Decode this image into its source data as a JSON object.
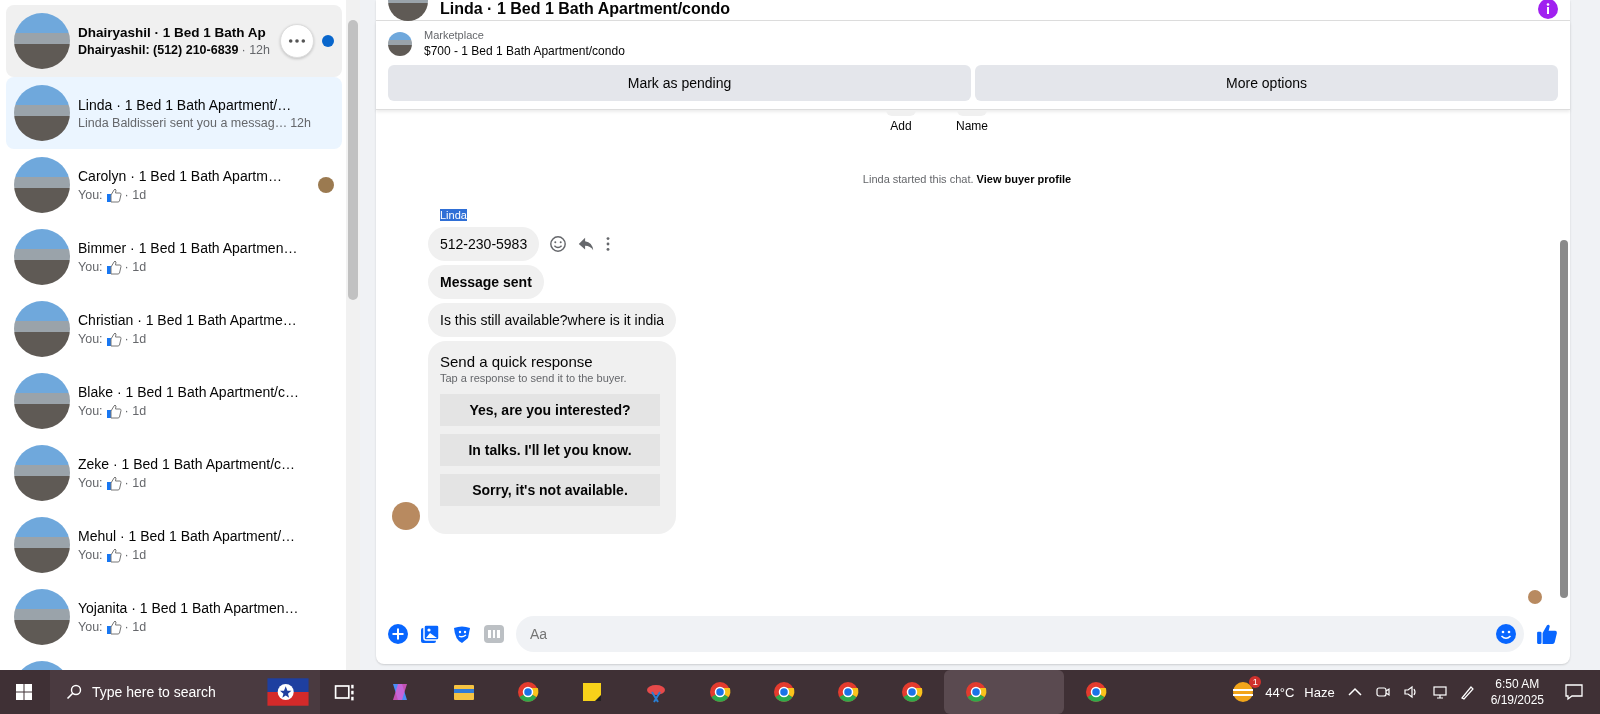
{
  "conversations": [
    {
      "title": "Dhairyashil · 1 Bed 1 Bath Ap",
      "kind": "text",
      "preview": "Dhairyashil: (512) 210-6839",
      "time": "· 12h",
      "unread": true,
      "hovered": true,
      "selected": false,
      "seen_avatar": false
    },
    {
      "title": "Linda · 1 Bed 1 Bath Apartment/…",
      "kind": "text",
      "preview": "Linda Baldisseri sent you a messag…",
      "time": "12h",
      "unread": false,
      "hovered": false,
      "selected": true,
      "seen_avatar": false
    },
    {
      "title": "Carolyn · 1 Bed 1 Bath Apartm…",
      "kind": "like",
      "preview": "You:",
      "time": "· 1d",
      "unread": false,
      "hovered": false,
      "selected": false,
      "seen_avatar": true
    },
    {
      "title": "Bimmer · 1 Bed 1 Bath Apartmen…",
      "kind": "like",
      "preview": "You:",
      "time": "· 1d",
      "unread": false,
      "hovered": false,
      "selected": false,
      "seen_avatar": false
    },
    {
      "title": "Christian · 1 Bed 1 Bath Apartme…",
      "kind": "like",
      "preview": "You:",
      "time": "· 1d",
      "unread": false,
      "hovered": false,
      "selected": false,
      "seen_avatar": false
    },
    {
      "title": "Blake · 1 Bed 1 Bath Apartment/c…",
      "kind": "like",
      "preview": "You:",
      "time": "· 1d",
      "unread": false,
      "hovered": false,
      "selected": false,
      "seen_avatar": false
    },
    {
      "title": "Zeke · 1 Bed 1 Bath Apartment/c…",
      "kind": "like",
      "preview": "You:",
      "time": "· 1d",
      "unread": false,
      "hovered": false,
      "selected": false,
      "seen_avatar": false
    },
    {
      "title": "Mehul · 1 Bed 1 Bath Apartment/…",
      "kind": "like",
      "preview": "You:",
      "time": "· 1d",
      "unread": false,
      "hovered": false,
      "selected": false,
      "seen_avatar": false
    },
    {
      "title": "Yojanita · 1 Bed 1 Bath Apartmen…",
      "kind": "like",
      "preview": "You:",
      "time": "· 1d",
      "unread": false,
      "hovered": false,
      "selected": false,
      "seen_avatar": false
    }
  ],
  "chat": {
    "title": "Linda · 1 Bed 1 Bath Apartment/condo",
    "listing": {
      "source": "Marketplace",
      "name": "$700 - 1 Bed 1 Bath Apartment/condo"
    },
    "actions": [
      "Mark as pending",
      "More options"
    ],
    "profile_actions": [
      "Add",
      "Name"
    ],
    "notice": {
      "text": "Linda started this chat.",
      "link": "View buyer profile"
    },
    "sender": "Linda",
    "messages": [
      {
        "kind": "text",
        "text": "512-230-5983",
        "bold": false,
        "hover_tools": true
      },
      {
        "kind": "text",
        "text": "Message sent",
        "bold": true,
        "hover_tools": false
      },
      {
        "kind": "text",
        "text": "Is this still available?where is it india",
        "bold": false,
        "hover_tools": false
      },
      {
        "kind": "quick",
        "title": "Send a quick response",
        "subtitle": "Tap a response to send it to the buyer.",
        "options": [
          "Yes, are you interested?",
          "In talks. I'll let you know.",
          "Sorry, it's not available."
        ]
      }
    ],
    "composer": {
      "placeholder": "Aa"
    }
  },
  "taskbar": {
    "search": {
      "placeholder": "Type here to search"
    },
    "weather": {
      "badge": "1",
      "temperature": "44°C",
      "condition": "Haze"
    },
    "time": "6:50 AM",
    "date": "6/19/2025"
  }
}
